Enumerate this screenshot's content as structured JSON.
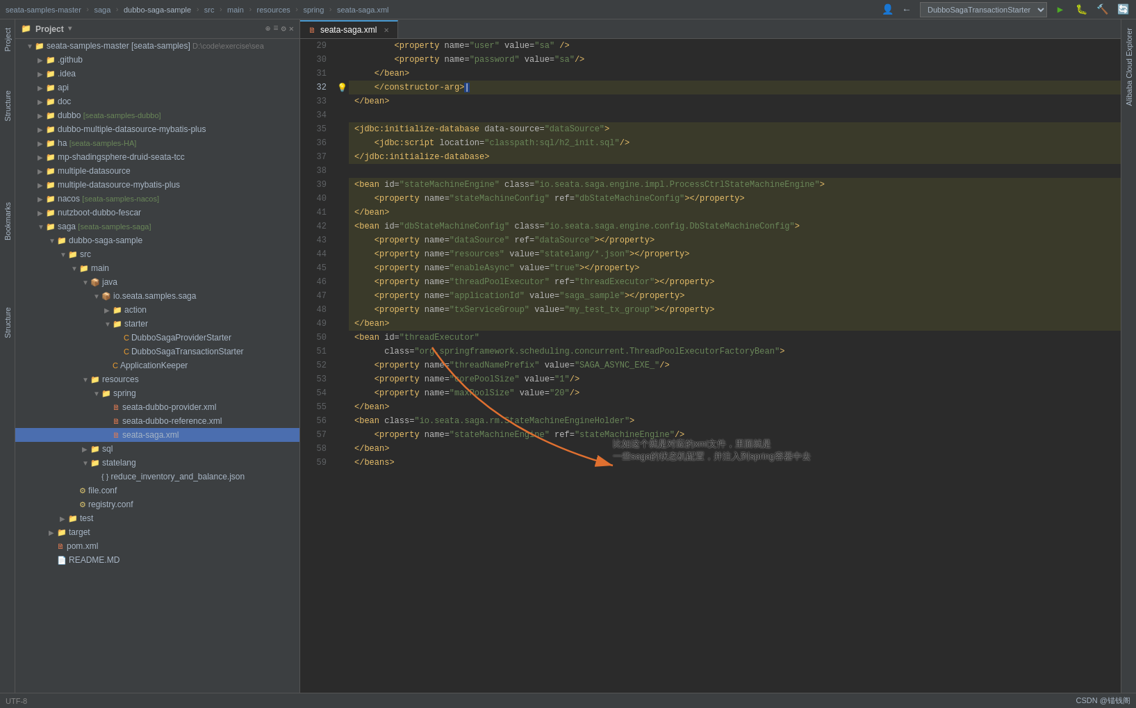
{
  "topbar": {
    "breadcrumbs": [
      "seata-samples-master",
      "saga",
      "dubbo-saga-sample",
      "src",
      "main",
      "resources",
      "spring",
      "seata-saga.xml"
    ],
    "run_config": "DubboSagaTransactionStarter"
  },
  "project_panel": {
    "title": "Project",
    "root": "seata-samples-master [seata-samples]",
    "root_path": "D:\\code\\exercise\\sea",
    "items": [
      {
        "level": 1,
        "label": ".github",
        "type": "folder",
        "expanded": false
      },
      {
        "level": 1,
        "label": ".idea",
        "type": "folder",
        "expanded": false
      },
      {
        "level": 1,
        "label": "api",
        "type": "folder",
        "expanded": false
      },
      {
        "level": 1,
        "label": "doc",
        "type": "folder",
        "expanded": false
      },
      {
        "level": 1,
        "label": "dubbo [seata-samples-dubbo]",
        "type": "folder",
        "expanded": false
      },
      {
        "level": 1,
        "label": "dubbo-multiple-datasource-mybatis-plus",
        "type": "folder",
        "expanded": false
      },
      {
        "level": 1,
        "label": "ha [seata-samples-HA]",
        "type": "folder",
        "expanded": false
      },
      {
        "level": 1,
        "label": "mp-shadingsphere-druid-seata-tcc",
        "type": "folder",
        "expanded": false
      },
      {
        "level": 1,
        "label": "multiple-datasource",
        "type": "folder",
        "expanded": false
      },
      {
        "level": 1,
        "label": "multiple-datasource-mybatis-plus",
        "type": "folder",
        "expanded": false
      },
      {
        "level": 1,
        "label": "nacos [seata-samples-nacos]",
        "type": "folder",
        "expanded": false
      },
      {
        "level": 1,
        "label": "nutzboot-dubbo-fescar",
        "type": "folder",
        "expanded": false
      },
      {
        "level": 1,
        "label": "saga [seata-samples-saga]",
        "type": "folder",
        "expanded": true
      },
      {
        "level": 2,
        "label": "dubbo-saga-sample",
        "type": "folder",
        "expanded": true
      },
      {
        "level": 3,
        "label": "src",
        "type": "folder",
        "expanded": true
      },
      {
        "level": 4,
        "label": "main",
        "type": "folder",
        "expanded": true
      },
      {
        "level": 5,
        "label": "java",
        "type": "folder-blue",
        "expanded": true
      },
      {
        "level": 6,
        "label": "io.seata.samples.saga",
        "type": "package",
        "expanded": true
      },
      {
        "level": 7,
        "label": "action",
        "type": "folder",
        "expanded": false
      },
      {
        "level": 7,
        "label": "starter",
        "type": "folder",
        "expanded": true
      },
      {
        "level": 8,
        "label": "DubboSagaProviderStarter",
        "type": "java"
      },
      {
        "level": 8,
        "label": "DubboSagaTransactionStarter",
        "type": "java"
      },
      {
        "level": 7,
        "label": "ApplicationKeeper",
        "type": "java"
      },
      {
        "level": 5,
        "label": "resources",
        "type": "folder",
        "expanded": true
      },
      {
        "level": 6,
        "label": "spring",
        "type": "folder",
        "expanded": true
      },
      {
        "level": 7,
        "label": "seata-dubbo-provider.xml",
        "type": "xml"
      },
      {
        "level": 7,
        "label": "seata-dubbo-reference.xml",
        "type": "xml"
      },
      {
        "level": 7,
        "label": "seata-saga.xml",
        "type": "xml",
        "selected": true
      },
      {
        "level": 5,
        "label": "sql",
        "type": "folder",
        "expanded": false
      },
      {
        "level": 5,
        "label": "statelang",
        "type": "folder",
        "expanded": true
      },
      {
        "level": 6,
        "label": "reduce_inventory_and_balance.json",
        "type": "json"
      },
      {
        "level": 4,
        "label": "file.conf",
        "type": "conf"
      },
      {
        "level": 4,
        "label": "registry.conf",
        "type": "conf"
      },
      {
        "level": 3,
        "label": "test",
        "type": "folder",
        "expanded": false
      },
      {
        "level": 2,
        "label": "target",
        "type": "folder",
        "expanded": false
      },
      {
        "level": 2,
        "label": "pom.xml",
        "type": "xml"
      },
      {
        "level": 2,
        "label": "README.MD",
        "type": "file"
      }
    ]
  },
  "editor": {
    "filename": "seata-saga.xml",
    "lines": [
      {
        "num": 29,
        "content": "        <property name=\"user\" value=\"sa\" />",
        "highlight": false
      },
      {
        "num": 30,
        "content": "        <property name=\"password\" value=\"sa\"/>",
        "highlight": false
      },
      {
        "num": 31,
        "content": "    </bean>",
        "highlight": false
      },
      {
        "num": 32,
        "content": "    </constructor-arg>|",
        "highlight": true,
        "has_bulb": true
      },
      {
        "num": 33,
        "content": "</bean>",
        "highlight": false
      },
      {
        "num": 34,
        "content": "",
        "highlight": false
      },
      {
        "num": 35,
        "content": "<jdbc:initialize-database data-source=\"dataSource\">",
        "highlight": true
      },
      {
        "num": 36,
        "content": "    <jdbc:script location=\"classpath:sql/h2_init.sql\"/>",
        "highlight": true
      },
      {
        "num": 37,
        "content": "</jdbc:initialize-database>",
        "highlight": true
      },
      {
        "num": 38,
        "content": "",
        "highlight": false
      },
      {
        "num": 39,
        "content": "<bean id=\"stateMachineEngine\" class=\"io.seata.saga.engine.impl.ProcessCtrlStateMachineEngine\">",
        "highlight": true
      },
      {
        "num": 40,
        "content": "    <property name=\"stateMachineConfig\" ref=\"dbStateMachineConfig\"></property>",
        "highlight": true
      },
      {
        "num": 41,
        "content": "</bean>",
        "highlight": true
      },
      {
        "num": 42,
        "content": "<bean id=\"dbStateMachineConfig\" class=\"io.seata.saga.engine.config.DbStateMachineConfig\">",
        "highlight": true
      },
      {
        "num": 43,
        "content": "    <property name=\"dataSource\" ref=\"dataSource\"></property>",
        "highlight": true
      },
      {
        "num": 44,
        "content": "    <property name=\"resources\" value=\"statelang/*.json\"></property>",
        "highlight": true
      },
      {
        "num": 45,
        "content": "    <property name=\"enableAsync\" value=\"true\"></property>",
        "highlight": true
      },
      {
        "num": 46,
        "content": "    <property name=\"threadPoolExecutor\" ref=\"threadExecutor\"></property>",
        "highlight": true
      },
      {
        "num": 47,
        "content": "    <property name=\"applicationId\" value=\"saga_sample\"></property>",
        "highlight": true
      },
      {
        "num": 48,
        "content": "    <property name=\"txServiceGroup\" value=\"my_test_tx_group\"></property>",
        "highlight": true
      },
      {
        "num": 49,
        "content": "</bean>",
        "highlight": true
      },
      {
        "num": 50,
        "content": "<bean id=\"threadExecutor\"",
        "highlight": false
      },
      {
        "num": 51,
        "content": "      class=\"org.springframework.scheduling.concurrent.ThreadPoolExecutorFactoryBean\">",
        "highlight": false
      },
      {
        "num": 52,
        "content": "    <property name=\"threadNamePrefix\" value=\"SAGA_ASYNC_EXE_\"/>",
        "highlight": false
      },
      {
        "num": 53,
        "content": "    <property name=\"corePoolSize\" value=\"1\"/>",
        "highlight": false
      },
      {
        "num": 54,
        "content": "    <property name=\"maxPoolSize\" value=\"20\"/>",
        "highlight": false
      },
      {
        "num": 55,
        "content": "</bean>",
        "highlight": false
      },
      {
        "num": 56,
        "content": "<bean class=\"io.seata.saga.rm.StateMachineEngineHolder\">",
        "highlight": false
      },
      {
        "num": 57,
        "content": "    <property name=\"stateMachineEngine\" ref=\"stateMachineEngine\"/>",
        "highlight": false
      },
      {
        "num": 58,
        "content": "</bean>",
        "highlight": false
      },
      {
        "num": 59,
        "content": "</beans>",
        "highlight": false
      }
    ]
  },
  "annotation": {
    "text_line1": "比如这个就是对应的xml文件，里面就是",
    "text_line2": "一些saga的状态机配置，并注入到spring容器中去"
  },
  "bottom_bar": {
    "info": "CSDN @锚钱阁"
  }
}
